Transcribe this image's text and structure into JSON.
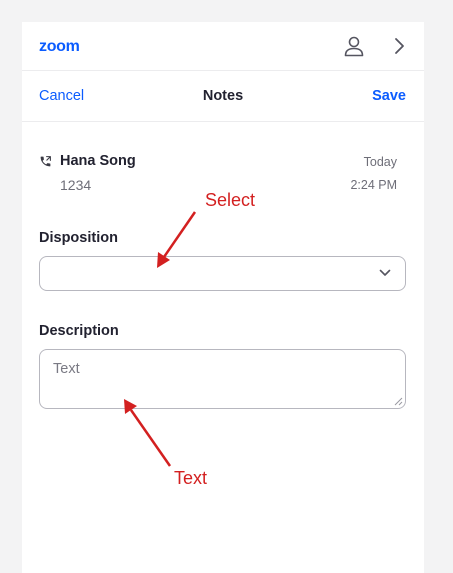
{
  "header": {
    "logo": "zoom",
    "icons": [
      "user-icon",
      "chevron-right-icon"
    ]
  },
  "notes_bar": {
    "cancel_label": "Cancel",
    "title": "Notes",
    "save_label": "Save"
  },
  "call": {
    "icon": "phone-icon",
    "name": "Hana Song",
    "number": "1234",
    "day": "Today",
    "time": "2:24 PM"
  },
  "disposition": {
    "label": "Disposition",
    "selected_value": ""
  },
  "description": {
    "label": "Description",
    "placeholder": "Text"
  },
  "annotations": {
    "select_callout": "Select",
    "text_callout": "Text"
  },
  "colors": {
    "brand": "#0b5cff",
    "annotation": "#d32020"
  }
}
